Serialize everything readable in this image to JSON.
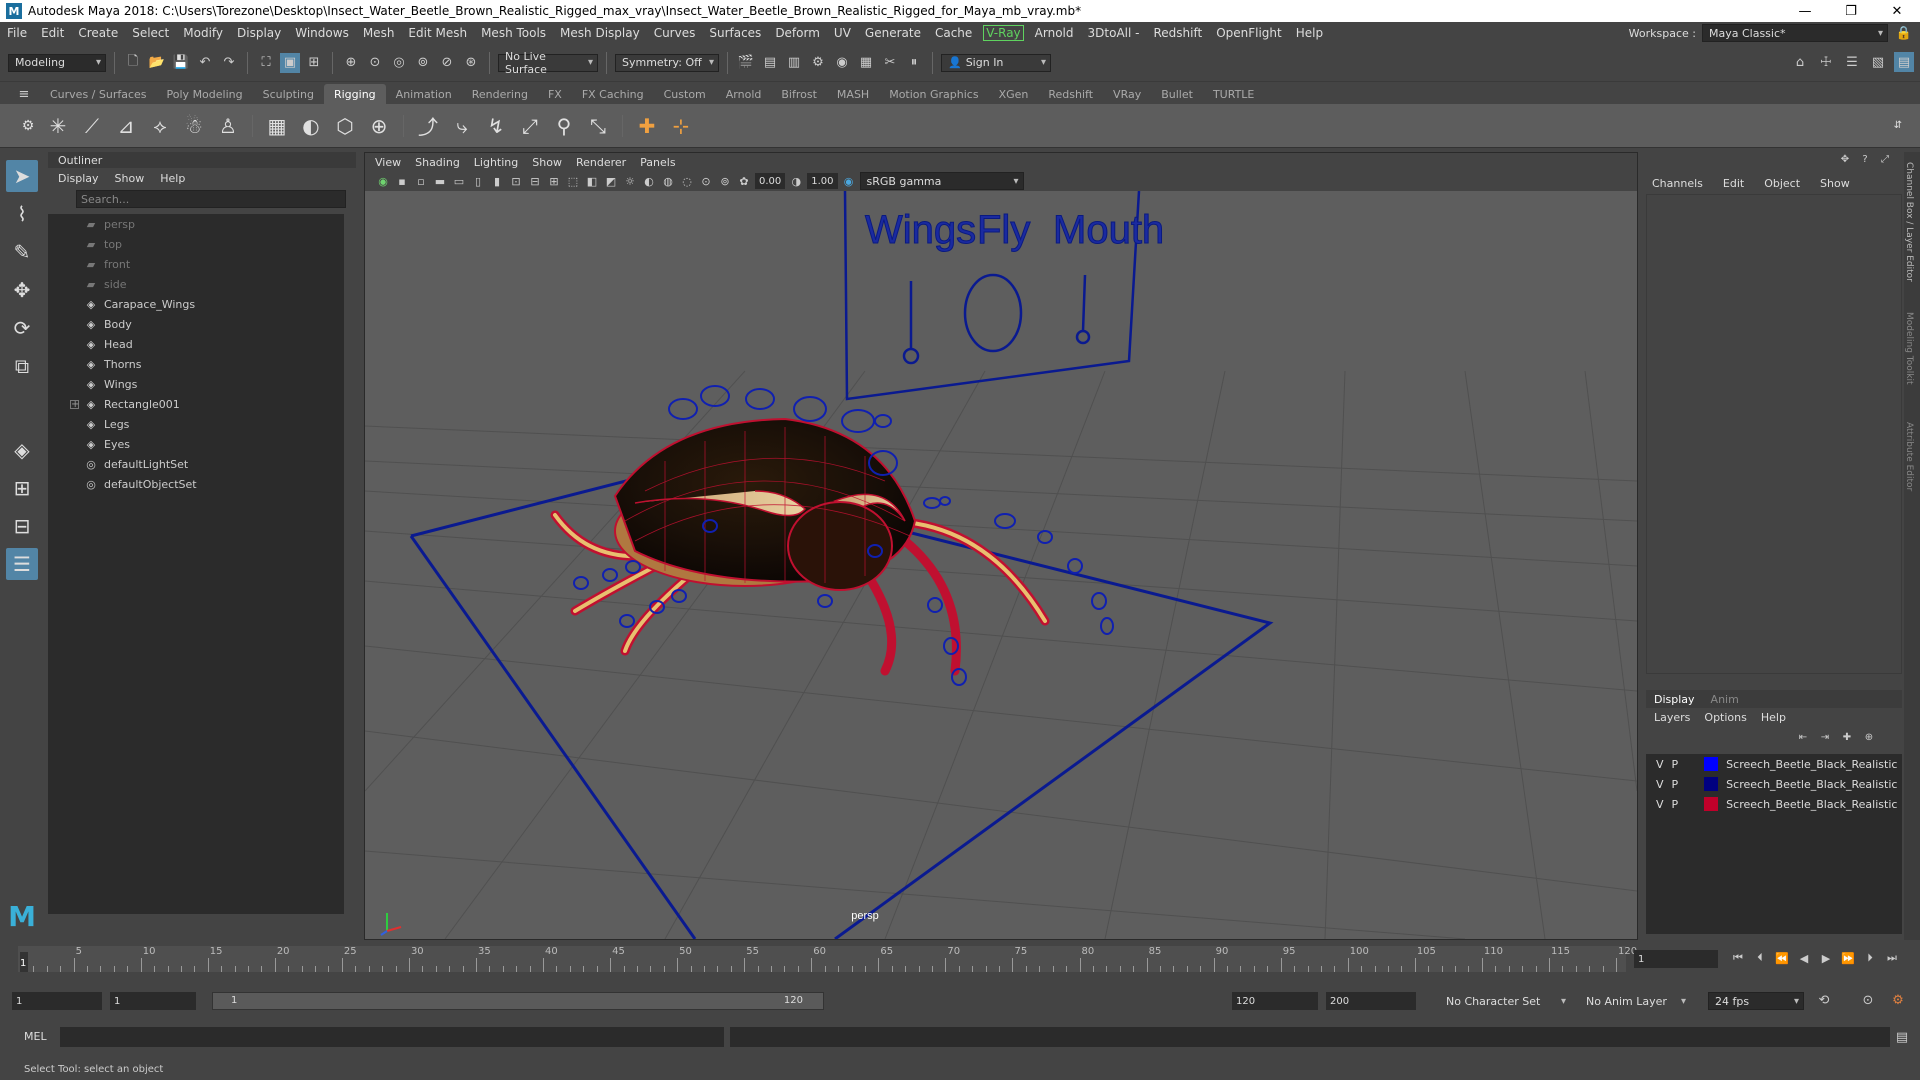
{
  "window": {
    "title": "Autodesk Maya 2018: C:\\Users\\Torezone\\Desktop\\Insect_Water_Beetle_Brown_Realistic_Rigged_max_vray\\Insect_Water_Beetle_Brown_Realistic_Rigged_for_Maya_mb_vray.mb*",
    "minimize": "—",
    "restore": "❐",
    "close": "✕"
  },
  "menubar": {
    "items": [
      "File",
      "Edit",
      "Create",
      "Select",
      "Modify",
      "Display",
      "Windows",
      "Mesh",
      "Edit Mesh",
      "Mesh Tools",
      "Mesh Display",
      "Curves",
      "Surfaces",
      "Deform",
      "UV",
      "Generate",
      "Cache"
    ],
    "vray": "V-Ray",
    "items2": [
      "Arnold",
      "3DtoAll -",
      "Redshift",
      "OpenFlight",
      "Help"
    ],
    "workspace_label": "Workspace :",
    "workspace_value": "Maya Classic*"
  },
  "statusline": {
    "mode": "Modeling",
    "live_surface": "No Live Surface",
    "symmetry": "Symmetry: Off",
    "sign_in": "Sign In"
  },
  "shelf": {
    "tabs": [
      "Curves / Surfaces",
      "Poly Modeling",
      "Sculpting",
      "Rigging",
      "Animation",
      "Rendering",
      "FX",
      "FX Caching",
      "Custom",
      "Arnold",
      "Bifrost",
      "MASH",
      "Motion Graphics",
      "XGen",
      "Redshift",
      "VRay",
      "Bullet",
      "TURTLE"
    ],
    "active_tab": "Rigging"
  },
  "outliner": {
    "title": "Outliner",
    "menus": [
      "Display",
      "Show",
      "Help"
    ],
    "search_placeholder": "Search...",
    "items": [
      {
        "label": "persp",
        "type": "camera"
      },
      {
        "label": "top",
        "type": "camera"
      },
      {
        "label": "front",
        "type": "camera"
      },
      {
        "label": "side",
        "type": "camera"
      },
      {
        "label": "Carapace_Wings",
        "type": "mesh"
      },
      {
        "label": "Body",
        "type": "mesh"
      },
      {
        "label": "Head",
        "type": "mesh"
      },
      {
        "label": "Thorns",
        "type": "mesh"
      },
      {
        "label": "Wings",
        "type": "mesh"
      },
      {
        "label": "Rectangle001",
        "type": "group"
      },
      {
        "label": "Legs",
        "type": "mesh"
      },
      {
        "label": "Eyes",
        "type": "mesh"
      },
      {
        "label": "defaultLightSet",
        "type": "set"
      },
      {
        "label": "defaultObjectSet",
        "type": "set"
      }
    ]
  },
  "viewport": {
    "menus": [
      "View",
      "Shading",
      "Lighting",
      "Show",
      "Renderer",
      "Panels"
    ],
    "field1": "0.00",
    "field2": "1.00",
    "color_space": "sRGB gamma",
    "camera_label": "persp",
    "control_board_labels": [
      "Wings",
      "Fly",
      "Mouth"
    ]
  },
  "channelbox": {
    "menus": [
      "Channels",
      "Edit",
      "Object",
      "Show"
    ],
    "layer_tabs": [
      "Display",
      "Anim"
    ],
    "layer_menus": [
      "Layers",
      "Options",
      "Help"
    ],
    "layers": [
      {
        "v": "V",
        "p": "P",
        "name": "Screech_Beetle_Black_Realistic",
        "color": "#0000ff"
      },
      {
        "v": "V",
        "p": "P",
        "name": "Screech_Beetle_Black_Realistic",
        "color": "#000080"
      },
      {
        "v": "V",
        "p": "P",
        "name": "Screech_Beetle_Black_Realistic",
        "color": "#c0002a"
      }
    ],
    "side_tabs": [
      "Channel Box / Layer Editor",
      "Modeling Toolkit",
      "Attribute Editor"
    ]
  },
  "timeline": {
    "current_frame": "1",
    "tick_labels": [
      "5",
      "10",
      "15",
      "20",
      "25",
      "30",
      "35",
      "40",
      "45",
      "50",
      "55",
      "60",
      "65",
      "70",
      "75",
      "80",
      "85",
      "90",
      "95",
      "100",
      "105",
      "110",
      "115",
      "120"
    ]
  },
  "range": {
    "start": "1",
    "playback_start": "1",
    "slider_start": "1",
    "slider_end": "120",
    "playback_end": "120",
    "end": "200",
    "character_set": "No Character Set",
    "anim_layer": "No Anim Layer",
    "fps": "24 fps"
  },
  "cmdline": {
    "label": "MEL"
  },
  "helpline": {
    "text": "Select Tool: select an object"
  }
}
